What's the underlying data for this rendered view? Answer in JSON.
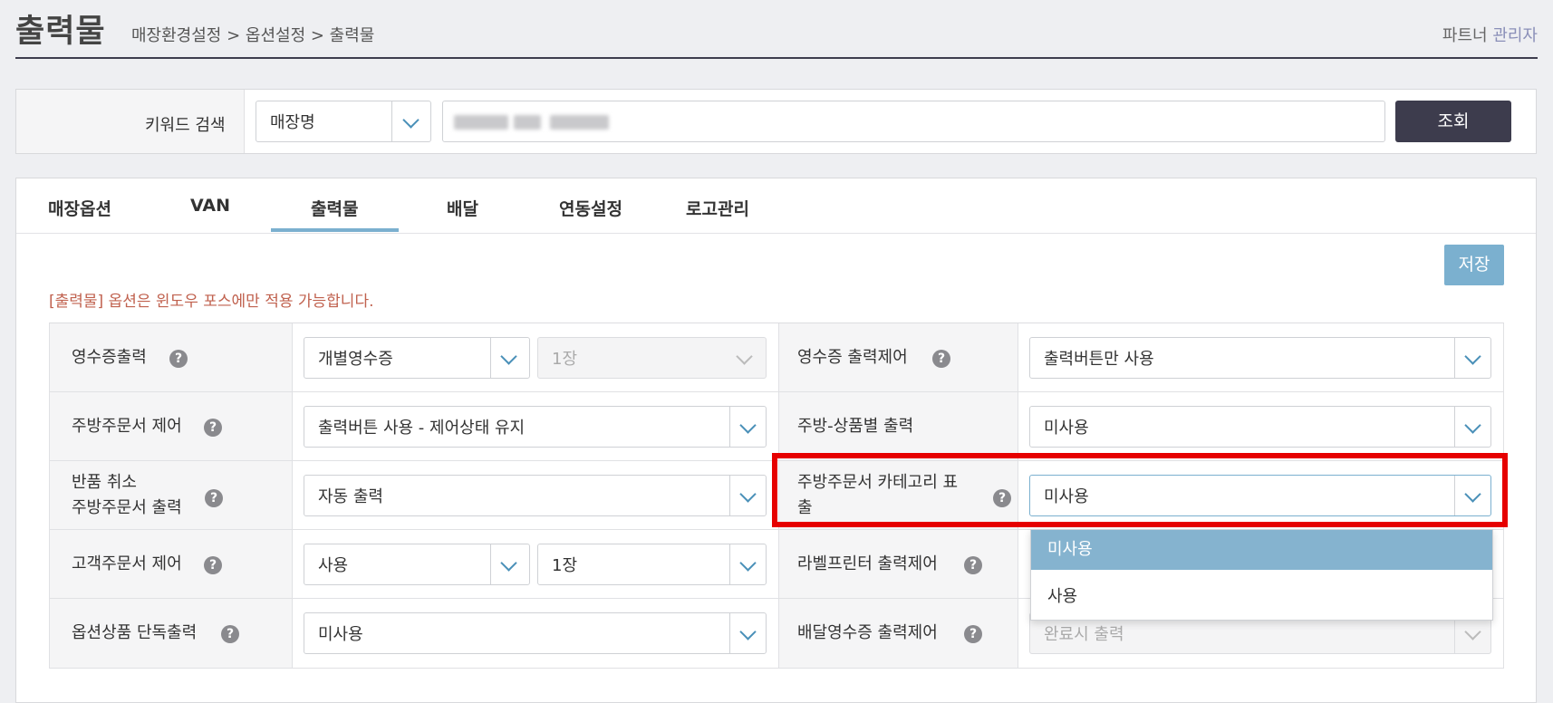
{
  "header": {
    "title": "출력물",
    "breadcrumb": "매장환경설정 > 옵션설정 > 출력물",
    "partner_label": "파트너",
    "partner_role": "관리자"
  },
  "search": {
    "label": "키워드 검색",
    "type_selected": "매장명",
    "button_label": "조회"
  },
  "tabs": [
    {
      "label": "매장옵션"
    },
    {
      "label": "VAN"
    },
    {
      "label": "출력물",
      "active": true
    },
    {
      "label": "배달"
    },
    {
      "label": "연동설정"
    },
    {
      "label": "로고관리"
    }
  ],
  "actions": {
    "save_label": "저장"
  },
  "notice": "[출력물] 옵션은 윈도우 포스에만 적용 가능합니다.",
  "help_glyph": "?",
  "options": {
    "receipt_print": {
      "label": "영수증출력",
      "value": "개별영수증",
      "count": "1장"
    },
    "receipt_control": {
      "label": "영수증 출력제어",
      "value": "출력버튼만 사용"
    },
    "kitchen_control": {
      "label": "주방주문서 제어",
      "value": "출력버튼 사용 - 제어상태 유지"
    },
    "kitchen_by_product": {
      "label": "주방-상품별 출력",
      "value": "미사용"
    },
    "refund_kitchen": {
      "label_line1": "반품 취소",
      "label_line2": "주방주문서 출력",
      "value": "자동 출력"
    },
    "kitchen_category": {
      "label_line1": "주방주문서 카테고리 표",
      "label_line2": "출",
      "value": "미사용"
    },
    "customer_order": {
      "label": "고객주문서 제어",
      "value": "사용",
      "count": "1장"
    },
    "label_printer": {
      "label": "라벨프린터 출력제어"
    },
    "option_product": {
      "label": "옵션상품 단독출력",
      "value": "미사용"
    },
    "delivery_receipt": {
      "label": "배달영수증 출력제어",
      "value": "완료시 출력"
    }
  },
  "dropdown": {
    "options": [
      {
        "label": "미사용",
        "selected": true
      },
      {
        "label": "사용",
        "selected": false
      }
    ]
  },
  "colors": {
    "accent": "#7bb0cf",
    "dark_button": "#3d3c4d",
    "notice": "#c0614e",
    "highlight": "#e60000"
  }
}
